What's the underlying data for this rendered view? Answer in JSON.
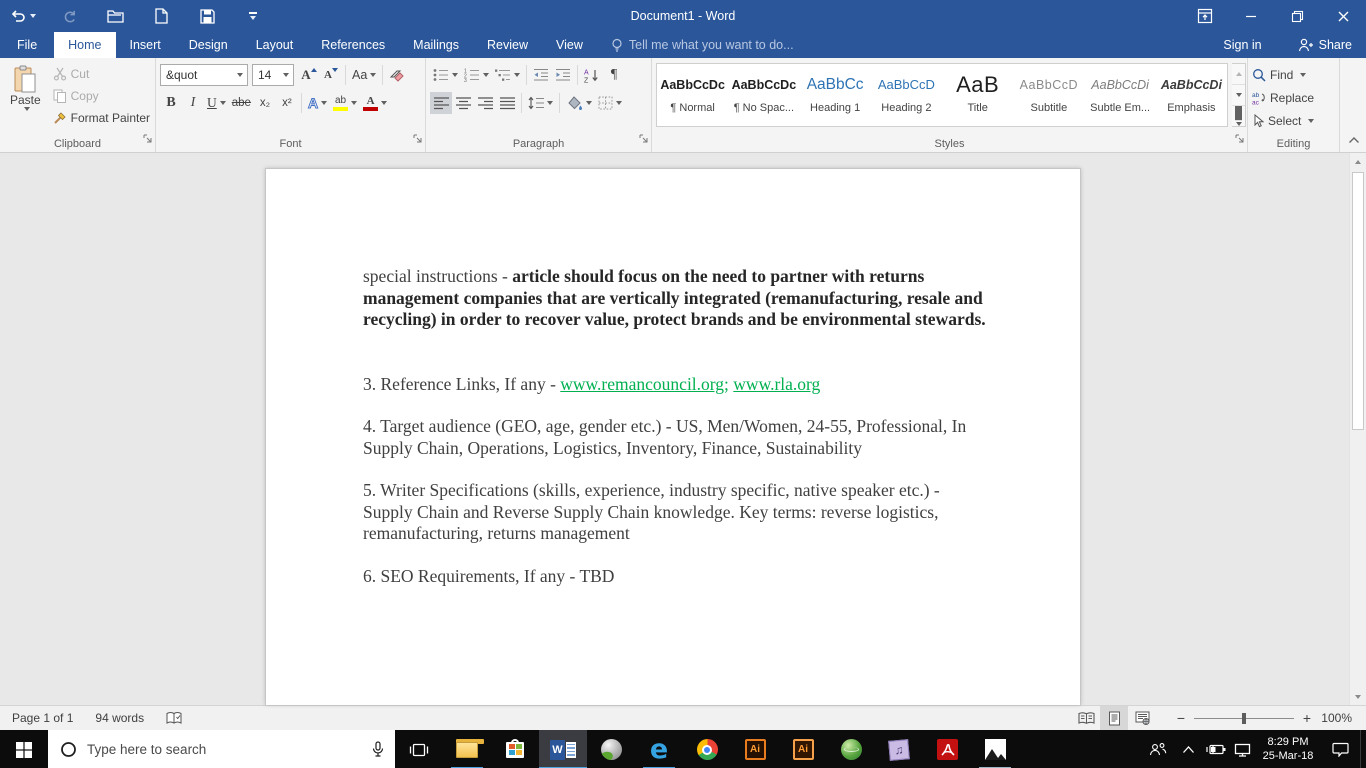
{
  "window": {
    "title": "Document1 - Word"
  },
  "qat": {
    "buttons": [
      "undo",
      "redo",
      "open",
      "new",
      "save",
      "customize-quick-access-toolbar"
    ]
  },
  "tabs": [
    {
      "label": "File",
      "active": false
    },
    {
      "label": "Home",
      "active": true
    },
    {
      "label": "Insert",
      "active": false
    },
    {
      "label": "Design",
      "active": false
    },
    {
      "label": "Layout",
      "active": false
    },
    {
      "label": "References",
      "active": false
    },
    {
      "label": "Mailings",
      "active": false
    },
    {
      "label": "Review",
      "active": false
    },
    {
      "label": "View",
      "active": false
    }
  ],
  "tell_me": "Tell me what you want to do...",
  "account": {
    "sign_in": "Sign in",
    "share": "Share"
  },
  "ribbon": {
    "clipboard": {
      "label": "Clipboard",
      "paste": "Paste",
      "cut": "Cut",
      "copy": "Copy",
      "format_painter": "Format Painter"
    },
    "font": {
      "label": "Font",
      "name": "&quot",
      "size": "14",
      "bold": "B",
      "italic": "I",
      "underline": "U",
      "strikethrough": "abe",
      "subscript": "x₂",
      "superscript": "x²",
      "change_case": "Aa",
      "text_effects": "A",
      "highlight": "ab",
      "font_color": "A"
    },
    "paragraph": {
      "label": "Paragraph",
      "pilcrow": "¶"
    },
    "styles": {
      "label": "Styles",
      "items": [
        {
          "preview": "AaBbCcDc",
          "name": "¶ Normal",
          "cls": "normal"
        },
        {
          "preview": "AaBbCcDc",
          "name": "¶ No Spac...",
          "cls": "normal"
        },
        {
          "preview": "AaBbCc",
          "name": "Heading 1",
          "cls": "h1"
        },
        {
          "preview": "AaBbCcD",
          "name": "Heading 2",
          "cls": "h2"
        },
        {
          "preview": "AaB",
          "name": "Title",
          "cls": "title"
        },
        {
          "preview": "AaBbCcD",
          "name": "Subtitle",
          "cls": "subtitle"
        },
        {
          "preview": "AaBbCcDi",
          "name": "Subtle Em...",
          "cls": "subtle"
        },
        {
          "preview": "AaBbCcDi",
          "name": "Emphasis",
          "cls": "emph"
        }
      ]
    },
    "editing": {
      "label": "Editing",
      "find": "Find",
      "replace": "Replace",
      "select": "Select"
    }
  },
  "document": {
    "paragraphs": [
      {
        "gap": "wide",
        "runs": [
          {
            "text": "special instructions - ",
            "style": "plain"
          },
          {
            "text": "article should focus on the need to partner with returns management companies that are vertically integrated (remanufacturing, resale and recycling) in order to recover value, protect brands and be environmental stewards.",
            "style": "bold"
          }
        ]
      },
      {
        "runs": [
          {
            "text": "3. Reference Links, If any - ",
            "style": "plain"
          },
          {
            "text": "www.remancouncil.org;",
            "style": "link"
          },
          {
            "text": " ",
            "style": "plain"
          },
          {
            "text": "www.rla.org",
            "style": "link"
          }
        ]
      },
      {
        "runs": [
          {
            "text": "4. Target audience (GEO, age, gender etc.) - US, Men/Women, 24-55, Professional, In Supply Chain, Operations, Logistics, Inventory, Finance, Sustainability",
            "style": "plain"
          }
        ]
      },
      {
        "runs": [
          {
            "text": "5. Writer Specifications (skills, experience, industry specific, native speaker etc.) - Supply Chain and Reverse Supply Chain knowledge. Key terms: reverse logistics, remanufacturing, returns management",
            "style": "plain"
          }
        ]
      },
      {
        "runs": [
          {
            "text": "6. SEO Requirements, If any - TBD",
            "style": "plain"
          }
        ]
      }
    ]
  },
  "status_bar": {
    "page": "Page 1 of 1",
    "words": "94 words",
    "zoom_level": "100%"
  },
  "taskbar": {
    "search_placeholder": "Type here to search",
    "apps": [
      {
        "name": "file-explorer",
        "running": true
      },
      {
        "name": "microsoft-store",
        "running": false
      },
      {
        "name": "word",
        "running": true,
        "active": true
      },
      {
        "name": "silver-utility-app",
        "running": false
      },
      {
        "name": "edge",
        "running": true
      },
      {
        "name": "chrome",
        "running": false
      },
      {
        "name": "illustrator",
        "running": false
      },
      {
        "name": "illustrator-alt",
        "running": false
      },
      {
        "name": "idm",
        "running": false
      },
      {
        "name": "music-app",
        "running": false
      },
      {
        "name": "acrobat-reader",
        "running": false
      },
      {
        "name": "photos",
        "running": true
      }
    ],
    "clock": {
      "time": "8:29 PM",
      "date": "25-Mar-18"
    }
  },
  "colors": {
    "titlebar": "#2b579a",
    "link_green": "#00b050",
    "heading_blue": "#2e74b5",
    "taskbar_underline": "#4ca3e0",
    "highlight_yellow": "#ffff00",
    "font_color_red": "#c00000"
  }
}
